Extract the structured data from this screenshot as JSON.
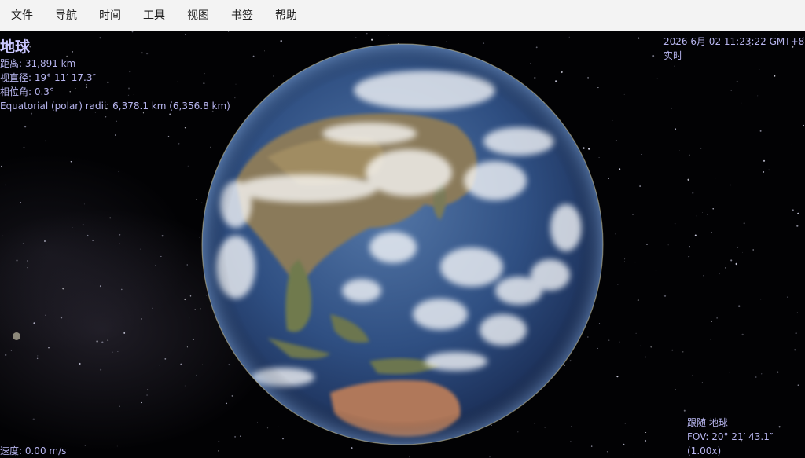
{
  "menu": {
    "items": [
      "文件",
      "导航",
      "时间",
      "工具",
      "视图",
      "书签",
      "帮助"
    ]
  },
  "object": {
    "name": "地球",
    "distance": "距离: 31,891 km",
    "apparent_diameter": "视直径: 19° 11′ 17.3″",
    "phase_angle": "相位角: 0.3°",
    "radii": "Equatorial (polar) radii: 6,378.1 km (6,356.8 km)"
  },
  "time": {
    "datetime": "2026 6月 02 11:23:22 GMT+8",
    "rate": "实时"
  },
  "status": {
    "speed": "速度: 0.00 m/s",
    "follow": "跟随 地球",
    "fov": "FOV: 20° 21′ 43.1″ (1.00x)"
  },
  "colors": {
    "hud_text": "#b8b6f0",
    "ocean": "#2c4a7e",
    "land": "#8a7a5a",
    "cloud": "#ffffff"
  }
}
